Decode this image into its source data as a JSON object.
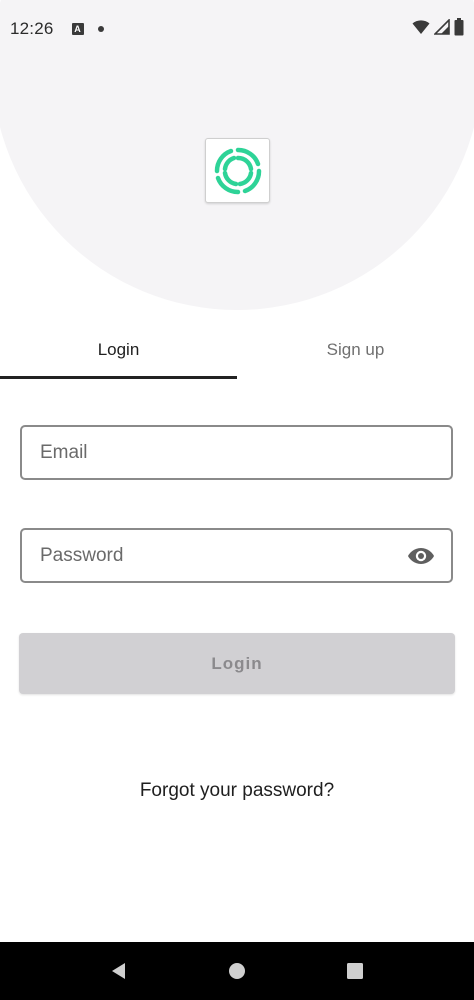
{
  "status_bar": {
    "time": "12:26",
    "icons": [
      "keyboard-a-icon",
      "dot-icon",
      "wifi-icon",
      "signal-icon",
      "battery-icon"
    ]
  },
  "logo": {
    "icon": "swirl-logo-icon",
    "color": "#2ed397"
  },
  "tabs": [
    {
      "label": "Login",
      "selected": true
    },
    {
      "label": "Sign up",
      "selected": false
    }
  ],
  "form": {
    "email": {
      "placeholder": "Email",
      "value": ""
    },
    "password": {
      "placeholder": "Password",
      "value": "",
      "toggle_icon": "eye-icon"
    },
    "login_button": "Login"
  },
  "forgot_password": "Forgot your password?",
  "nav_bar": {
    "icons": [
      "back-icon",
      "home-icon",
      "recents-icon"
    ]
  },
  "colors": {
    "accent": "#2ed397",
    "hero_background": "#f5f4f6",
    "button_disabled": "#d1d0d3"
  }
}
